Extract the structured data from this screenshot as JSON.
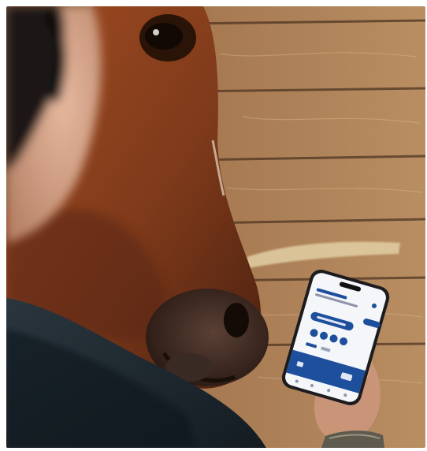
{
  "scene": {
    "subject": "horse-head",
    "colors": {
      "wood_light": "#b88a5c",
      "wood_mid": "#8e6644",
      "wood_dark": "#5a3c26",
      "horse_coat": "#8a3f1c",
      "horse_dark": "#3a1a0c",
      "jacket": "#1d2830",
      "skin": "#d9a58a",
      "phone_frame": "#1c1c1e",
      "app_blue": "#1e4f9c",
      "app_white": "#f4f6fa"
    }
  },
  "phone_app": {
    "hero_text": "",
    "section_title": "",
    "nav_icons": [
      "home-icon",
      "list-icon",
      "chat-icon",
      "profile-icon"
    ]
  }
}
